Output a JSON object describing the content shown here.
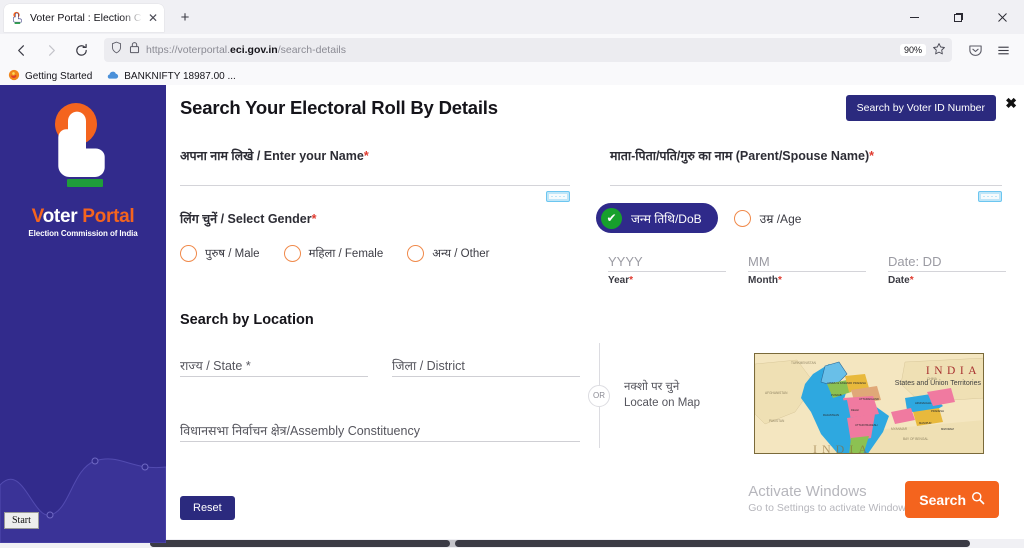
{
  "browser": {
    "tab": {
      "title": "Voter Portal : Election Commiss",
      "close_label": "✕",
      "favicon_name": "voter-portal-favicon"
    },
    "newtab_label": "+",
    "window_controls": {
      "minimize": "─",
      "maximize": "❐",
      "close": "✕"
    },
    "nav": {
      "back": "←",
      "forward": "→",
      "reload": "⟳"
    },
    "url": {
      "prefix": "https://voterportal.",
      "domain": "eci.gov.in",
      "path": "/search-details",
      "shield_icon": "shield-icon",
      "lock_icon": "lock-icon"
    },
    "zoom_level": "90%",
    "bookmark_star": "☆",
    "pocket_icon": "pocket-icon",
    "menu_icon": "≡",
    "bookmarks": [
      {
        "label": "Getting Started",
        "icon": "firefox-icon"
      },
      {
        "label": "BANKNIFTY 18987.00 ...",
        "icon": "cloud-icon"
      }
    ]
  },
  "sidebar": {
    "logo_v": "V",
    "logo_oter": "oter",
    "logo_portal": "Portal",
    "logo_subtitle": "Election Commission of India"
  },
  "header": {
    "title": "Search Your Electoral Roll By Details",
    "voter_id_button": "Search by Voter ID Number",
    "close_label": "✖"
  },
  "form": {
    "name": {
      "label_hi": "अपना नाम लिखे / ",
      "label_en": "Enter your Name",
      "required": "*",
      "value": "",
      "placeholder": ""
    },
    "parent": {
      "label_hi": "माता-पिता/पति/गुरु का नाम ",
      "label_en": "(Parent/Spouse Name)",
      "required": "*",
      "value": "",
      "placeholder": ""
    },
    "gender": {
      "label_hi": "लिंग चुनें / ",
      "label_en": "Select Gender",
      "required": "*",
      "options": [
        {
          "label": "पुरुष / Male",
          "selected": false
        },
        {
          "label": "महिला / Female",
          "selected": false
        },
        {
          "label": "अन्य / Other",
          "selected": false
        }
      ]
    },
    "dob_toggle": {
      "dob_label": "जन्म तिथि/DoB",
      "dob_selected": true,
      "check_glyph": "✔",
      "age_label": "उम्र /Age",
      "age_selected": false
    },
    "date": {
      "year": {
        "placeholder": "YYYY",
        "sub": "Year",
        "required": "*",
        "value": ""
      },
      "month": {
        "placeholder": "MM",
        "sub": "Month",
        "required": "*",
        "value": ""
      },
      "day": {
        "placeholder": "Date: DD",
        "sub": "Date",
        "required": "*",
        "value": ""
      }
    },
    "location": {
      "title": "Search by Location",
      "state_placeholder": "राज्य / State *",
      "district_placeholder": "जिला / District",
      "assembly_placeholder": "विधानसभा निर्वाचन क्षेत्र/Assembly Constituency",
      "state_value": "",
      "district_value": "",
      "assembly_value": "",
      "or_label": "OR",
      "locate_hi": "नक्शो पर चुने",
      "locate_en": "Locate on Map",
      "map_title": "INDIA",
      "map_subtitle": "States and Union Territories",
      "map_bigword": "INDIA"
    },
    "reset_button": "Reset",
    "search_button": "Search",
    "search_icon": "magnifier-icon",
    "keyboard_badge_icon": "virtual-keyboard-icon"
  },
  "watermark": {
    "line1": "Activate Windows",
    "line2": "Go to Settings to activate Windows."
  },
  "taskbar": {
    "start_label": "Start"
  },
  "colors": {
    "brand_navy": "#322b8c",
    "brand_orange": "#f4641e",
    "check_green": "#17a02c",
    "button_navy": "#2b2a7e",
    "required_red": "#e03a2f"
  }
}
